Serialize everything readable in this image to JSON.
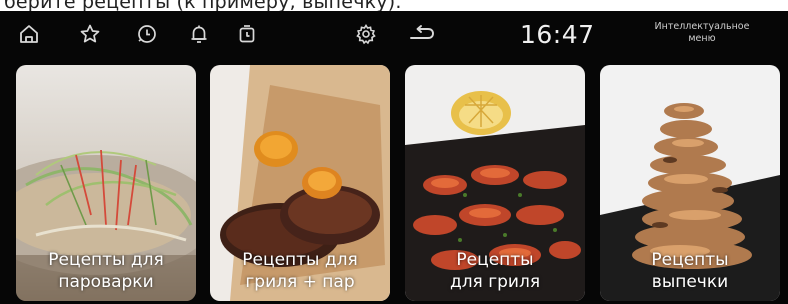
{
  "caption": "берите рецепты (к примеру, выпечку).",
  "topbar": {
    "icons": [
      "home-icon",
      "favorite-star-icon",
      "clock-history-icon",
      "bell-icon",
      "timer-icon",
      "settings-gear-icon",
      "back-arrow-icon"
    ],
    "time": "16:47",
    "smart_menu": "Интеллектуальное\nменю"
  },
  "cards": [
    {
      "id": "steamer",
      "label": "Рецепты для\nпароварки",
      "icon": "steamed-fish-image"
    },
    {
      "id": "grill-steam",
      "label": "Рецепты для\nгриля + пар",
      "icon": "baked-sweet-potato-image"
    },
    {
      "id": "grill",
      "label": "Рецепты\nдля гриля",
      "icon": "grilled-shrimp-image"
    },
    {
      "id": "baking",
      "label": "Рецепты\nвыпечки",
      "icon": "pastry-image"
    }
  ],
  "colors": {
    "screen_bg": "#060606",
    "icon": "#d9d9d9",
    "text": "#ffffff"
  }
}
